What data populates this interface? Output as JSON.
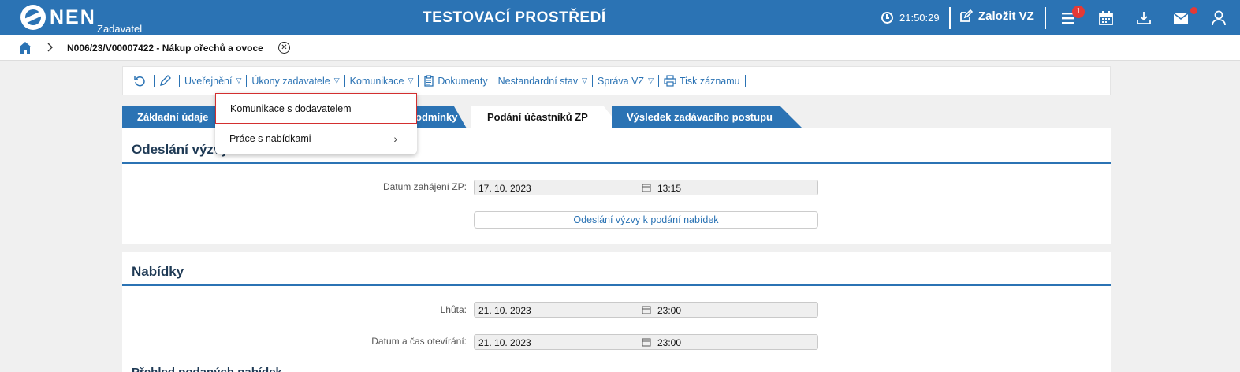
{
  "header": {
    "logo_text": "NEN",
    "logo_sub": "Zadavatel",
    "env_title": "TESTOVACÍ PROSTŘEDÍ",
    "clock": "21:50:29",
    "create_label": "Založit VZ",
    "menu_badge": "1",
    "accent_color": "#2b73b4"
  },
  "breadcrumb": {
    "text": "N006/23/V00007422 - Nákup ořechů a ovoce"
  },
  "toolbar": {
    "items": [
      {
        "label": "Uveřejnění"
      },
      {
        "label": "Úkony zadavatele"
      },
      {
        "label": "Komunikace"
      },
      {
        "label": "Dokumenty"
      },
      {
        "label": "Nestandardní stav"
      },
      {
        "label": "Správa VZ"
      },
      {
        "label": "Tisk záznamu"
      }
    ]
  },
  "tabs": [
    {
      "label": "Základní údaje"
    },
    {
      "label": "odmínky"
    },
    {
      "label": "Podání účastníků ZP"
    },
    {
      "label": "Výsledek zadávacího postupu"
    }
  ],
  "dropdown": {
    "items": [
      {
        "label": "Komunikace s dodavatelem"
      },
      {
        "label": "Práce s nabídkami"
      }
    ]
  },
  "section1": {
    "title": "Odeslání výzvy",
    "field_label": "Datum zahájení ZP:",
    "date": "17. 10. 2023",
    "time": "13:15",
    "button": "Odeslání výzvy k podání nabídek"
  },
  "section2": {
    "title": "Nabídky",
    "deadline_label": "Lhůta:",
    "deadline_date": "21. 10. 2023",
    "deadline_time": "23:00",
    "opening_label": "Datum a čas otevírání:",
    "opening_date": "21. 10. 2023",
    "opening_time": "23:00",
    "cut_text": "Přehled podaných nabídek"
  }
}
